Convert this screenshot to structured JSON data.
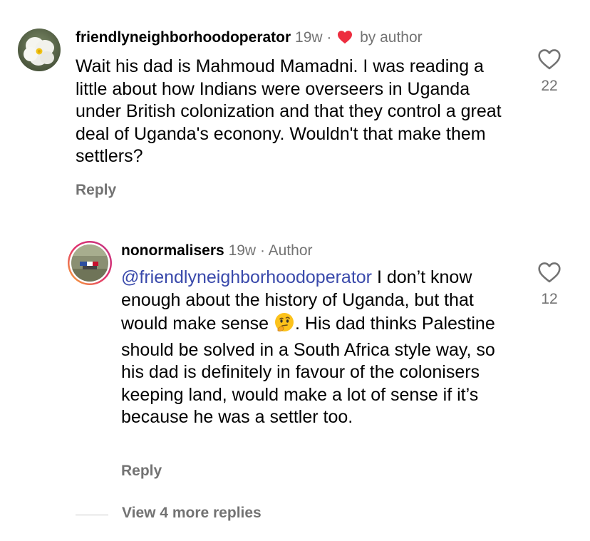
{
  "comments": [
    {
      "username": "friendlyneighborhoodoperator",
      "time": "19w",
      "separator": "·",
      "badge": "by author",
      "badge_icon": "heart-icon",
      "text": "Wait his dad is Mahmoud Mamadni. I was reading a little about how Indians were overseers in Uganda under British colonization and that they control a great deal of Uganda's econony. Wouldn't that make them settlers?",
      "reply_label": "Reply",
      "likes": "22",
      "like_icon": "heart-outline-icon"
    },
    {
      "username": "nonormalisers",
      "time": "19w",
      "separator": "·",
      "badge": "Author",
      "mention": "@friendlyneighborhoodoperator",
      "text_part1": " I don’t know enough about the history of Uganda, but that would make sense ",
      "emoji": "thinking-face-emoji",
      "text_part2": ". His dad thinks Palestine should be solved in a South Africa style way, so his dad is definitely in favour of the colonisers keeping land, would make a lot of sense if it’s because he was a settler too.",
      "reply_label": "Reply",
      "likes": "12",
      "like_icon": "heart-outline-icon"
    }
  ],
  "view_more_label": "View 4 more replies",
  "colors": {
    "muted": "#737373",
    "mention": "#3949ab",
    "heart": "#ed2d3f",
    "story_ring": [
      "#f9b234",
      "#e1306c",
      "#c13584"
    ]
  }
}
